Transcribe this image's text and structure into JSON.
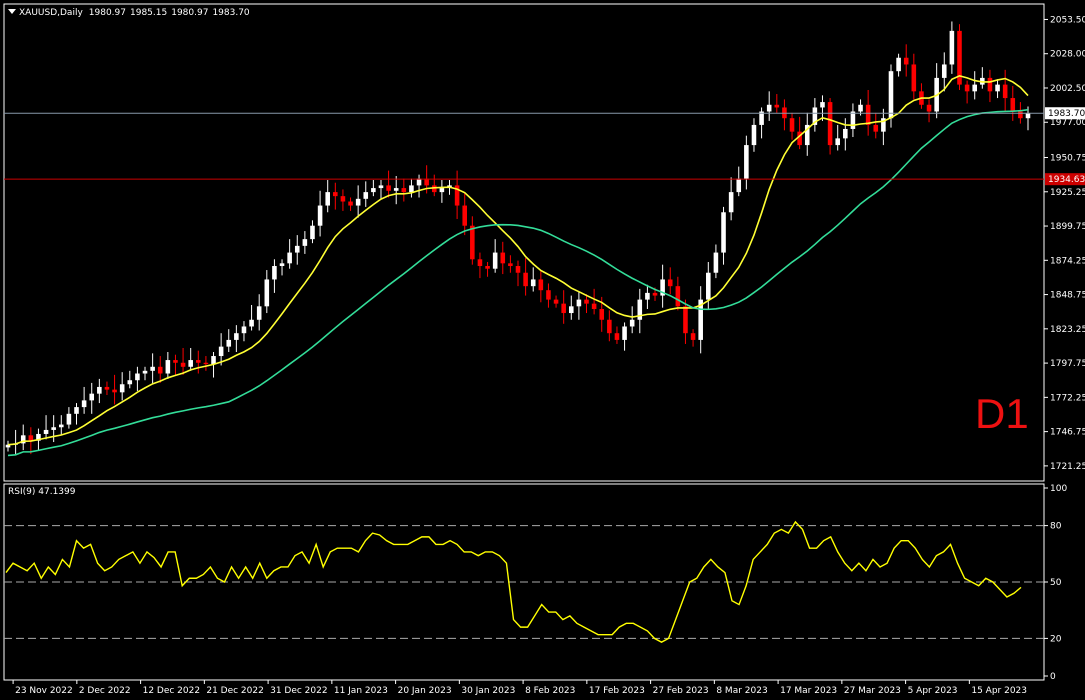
{
  "window": {
    "symbol_label": "XAUUSD,Daily",
    "ohlc": [
      "1980.97",
      "1985.15",
      "1980.97",
      "1983.70"
    ],
    "timeframe_badge": "D1"
  },
  "colors": {
    "background": "#000000",
    "bull_candle": "#ffffff",
    "bear_candle": "#ff0000",
    "ma_fast": "#ffff33",
    "ma_slow": "#33dd99",
    "rsi": "#ffff00",
    "bid_line": "#8899aa",
    "level_line": "#cc0000",
    "grid_text": "#ffffff"
  },
  "chart_data": [
    {
      "type": "candlestick",
      "title": "XAUUSD,Daily",
      "ylim": [
        1710,
        2065
      ],
      "y_ticks": [
        "2053.50",
        "2028.00",
        "2002.50",
        "1977.00",
        "1950.75",
        "1925.25",
        "1899.75",
        "1874.25",
        "1848.75",
        "1823.25",
        "1797.75",
        "1772.25",
        "1746.75",
        "1721.25"
      ],
      "y_tick_values": [
        2053.5,
        2028.0,
        2002.5,
        1977.0,
        1950.75,
        1925.25,
        1899.75,
        1874.25,
        1848.75,
        1823.25,
        1797.75,
        1772.25,
        1746.75,
        1721.25
      ],
      "x_labels": [
        "23 Nov 2022",
        "2 Dec 2022",
        "12 Dec 2022",
        "21 Dec 2022",
        "31 Dec 2022",
        "11 Jan 2023",
        "20 Jan 2023",
        "30 Jan 2023",
        "8 Feb 2023",
        "17 Feb 2023",
        "27 Feb 2023",
        "8 Mar 2023",
        "17 Mar 2023",
        "27 Mar 2023",
        "5 Apr 2023",
        "15 Apr 2023"
      ],
      "current_price": {
        "label": "1983.70",
        "value": 1983.7
      },
      "horizontal_level": {
        "label": "1934.63",
        "value": 1934.63
      },
      "closes": [
        1737,
        1738,
        1744,
        1740,
        1745,
        1748,
        1750,
        1752,
        1760,
        1765,
        1770,
        1775,
        1780,
        1778,
        1776,
        1782,
        1785,
        1790,
        1792,
        1795,
        1790,
        1800,
        1798,
        1795,
        1800,
        1798,
        1797,
        1803,
        1810,
        1815,
        1820,
        1825,
        1830,
        1840,
        1860,
        1870,
        1872,
        1880,
        1885,
        1890,
        1900,
        1915,
        1925,
        1922,
        1918,
        1915,
        1920,
        1925,
        1928,
        1930,
        1926,
        1928,
        1925,
        1930,
        1935,
        1930,
        1925,
        1928,
        1930,
        1915,
        1900,
        1875,
        1870,
        1868,
        1880,
        1872,
        1870,
        1865,
        1855,
        1860,
        1852,
        1845,
        1842,
        1835,
        1840,
        1845,
        1842,
        1838,
        1830,
        1820,
        1815,
        1825,
        1830,
        1845,
        1850,
        1848,
        1860,
        1855,
        1840,
        1820,
        1815,
        1845,
        1865,
        1880,
        1910,
        1925,
        1935,
        1960,
        1975,
        1985,
        1990,
        1988,
        1980,
        1970,
        1960,
        1975,
        1988,
        1992,
        1960,
        1965,
        1972,
        1985,
        1990,
        1975,
        1970,
        1980,
        2015,
        2025,
        2020,
        2000,
        1990,
        1985,
        2010,
        2020,
        2045,
        2005,
        2000,
        2005,
        2010,
        2000,
        2005,
        1995,
        1985,
        1980,
        1983.7
      ],
      "ma_fast_label": "yellow moving average",
      "ma_slow_label": "green moving average"
    },
    {
      "type": "line",
      "title": "RSI(9) 47.1399",
      "ylim": [
        0,
        100
      ],
      "y_ticks": [
        "100",
        "80",
        "50",
        "20",
        "0"
      ],
      "y_tick_values": [
        100,
        80,
        50,
        20,
        0
      ],
      "levels": [
        80,
        50,
        20
      ],
      "rsi_label": "RSI(9)",
      "rsi_value": "47.1399",
      "values": [
        55,
        60,
        58,
        56,
        60,
        52,
        58,
        54,
        62,
        58,
        72,
        68,
        70,
        60,
        56,
        58,
        62,
        64,
        66,
        60,
        66,
        63,
        58,
        66,
        66,
        48,
        52,
        52,
        54,
        58,
        52,
        50,
        58,
        52,
        58,
        52,
        60,
        52,
        56,
        58,
        58,
        64,
        66,
        60,
        70,
        58,
        66,
        68,
        68,
        68,
        66,
        72,
        76,
        75,
        72,
        70,
        70,
        70,
        72,
        74,
        74,
        70,
        70,
        72,
        70,
        66,
        66,
        64,
        66,
        66,
        64,
        60,
        30,
        26,
        26,
        32,
        38,
        34,
        34,
        30,
        32,
        28,
        26,
        24,
        22,
        22,
        22,
        26,
        28,
        28,
        26,
        24,
        20,
        18,
        20,
        30,
        40,
        50,
        52,
        58,
        62,
        58,
        55,
        40,
        38,
        48,
        62,
        66,
        70,
        76,
        78,
        76,
        82,
        78,
        68,
        68,
        72,
        74,
        66,
        60,
        56,
        60,
        56,
        62,
        58,
        60,
        68,
        72,
        72,
        68,
        62,
        58,
        64,
        66,
        70,
        60,
        52,
        50,
        48,
        52,
        50,
        46,
        42,
        44,
        47.14
      ]
    }
  ]
}
